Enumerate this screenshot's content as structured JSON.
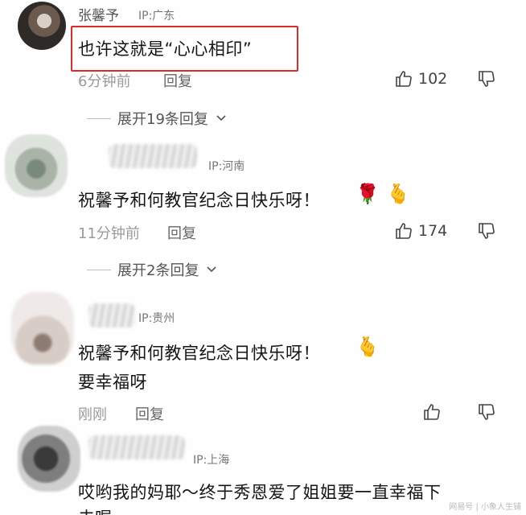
{
  "comments": [
    {
      "username": "张馨予",
      "ip": "IP:广东",
      "text": "也许这就是“心心相印”",
      "time": "6分钟前",
      "reply_label": "回复",
      "likes": "102"
    },
    {
      "username": "",
      "ip": "IP:河南",
      "text": "祝馨予和何教官纪念日快乐呀！",
      "time": "11分钟前",
      "reply_label": "回复",
      "likes": "174"
    },
    {
      "username": "",
      "ip": "IP:贵州",
      "text": "祝馨予和何教官纪念日快乐呀！",
      "text2": "要幸福呀",
      "time": "刚刚",
      "reply_label": "回复",
      "likes": ""
    },
    {
      "username": "",
      "ip": "IP:上海",
      "text": "哎哟我的妈耶～终于秀恩爱了姐姐要一直幸福下",
      "text2": "去喔"
    }
  ],
  "expand_replies": [
    {
      "label": "展开19条回复"
    },
    {
      "label": "展开2条回复"
    }
  ],
  "watermark": "网易号 | 小象人生铺",
  "colors": {
    "highlight": "#e02b2b",
    "text": "#151515",
    "meta": "#9a9a9a"
  },
  "icons": [
    "thumbs-up-icon",
    "thumbs-down-icon",
    "chevron-down-icon",
    "rose-icon",
    "finger-heart-icon"
  ]
}
